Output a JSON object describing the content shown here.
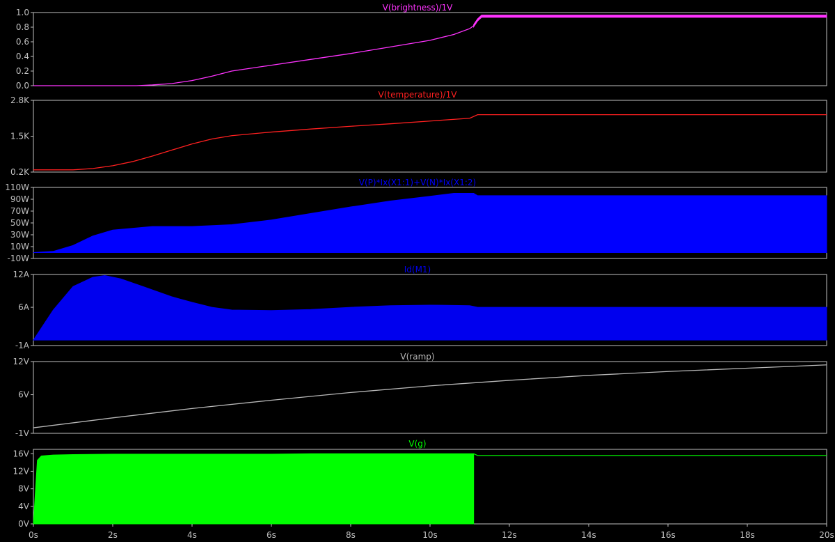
{
  "x_axis": {
    "ticks": [
      "0s",
      "2s",
      "4s",
      "6s",
      "8s",
      "10s",
      "12s",
      "14s",
      "16s",
      "18s",
      "20s"
    ],
    "range": [
      0,
      20
    ]
  },
  "chart_data": [
    {
      "type": "line",
      "title": "V(brightness)/1V",
      "color": "#ff33ff",
      "ylim": [
        0,
        1.0
      ],
      "yticks": [
        {
          "v": 1.0,
          "label": "1.0"
        },
        {
          "v": 0.8,
          "label": "0.8"
        },
        {
          "v": 0.6,
          "label": "0.6"
        },
        {
          "v": 0.4,
          "label": "0.4"
        },
        {
          "v": 0.2,
          "label": "0.2"
        },
        {
          "v": 0.0,
          "label": "0.0"
        }
      ],
      "band": 0.015,
      "band_start": 11.1,
      "x": [
        0,
        2.6,
        3.0,
        3.5,
        4.0,
        4.5,
        5.0,
        6.0,
        7.0,
        8.0,
        9.0,
        10.0,
        10.6,
        11.0,
        11.1,
        11.2,
        11.3,
        12,
        14,
        16,
        18,
        20
      ],
      "y": [
        0,
        0,
        0.01,
        0.03,
        0.07,
        0.13,
        0.2,
        0.28,
        0.36,
        0.44,
        0.53,
        0.62,
        0.7,
        0.78,
        0.82,
        0.9,
        0.95,
        0.95,
        0.95,
        0.95,
        0.95,
        0.95
      ]
    },
    {
      "type": "line",
      "title": "V(temperature)/1V",
      "color": "#ff2020",
      "ylim": [
        200,
        2800
      ],
      "yticks": [
        {
          "v": 2800,
          "label": "2.8K"
        },
        {
          "v": 1500,
          "label": "1.5K"
        },
        {
          "v": 200,
          "label": "0.2K"
        }
      ],
      "x": [
        0,
        1.0,
        1.5,
        2.0,
        2.5,
        3.0,
        3.5,
        4.0,
        4.5,
        5.0,
        6.0,
        7.0,
        8.0,
        9.0,
        10.0,
        11.0,
        11.2,
        12,
        14,
        16,
        18,
        20
      ],
      "y": [
        280,
        280,
        330,
        430,
        580,
        780,
        1000,
        1220,
        1400,
        1520,
        1650,
        1760,
        1860,
        1950,
        2050,
        2150,
        2280,
        2280,
        2280,
        2280,
        2280,
        2280
      ]
    },
    {
      "type": "area",
      "title": "V(P)*Ix(X1:1)+V(N)*Ix(X1:2)",
      "color": "#0000ff",
      "ylim": [
        -10,
        110
      ],
      "yticks": [
        {
          "v": 110,
          "label": "110W"
        },
        {
          "v": 90,
          "label": "90W"
        },
        {
          "v": 70,
          "label": "70W"
        },
        {
          "v": 50,
          "label": "50W"
        },
        {
          "v": 30,
          "label": "30W"
        },
        {
          "v": 10,
          "label": "10W"
        },
        {
          "v": -10,
          "label": "-10W"
        }
      ],
      "baseline": 0,
      "x": [
        0,
        0.5,
        1.0,
        1.5,
        2.0,
        3.0,
        4.0,
        5.0,
        6.0,
        7.0,
        8.0,
        9.0,
        10.0,
        10.6,
        11.1,
        11.2,
        12,
        14,
        16,
        18,
        20
      ],
      "y": [
        0,
        2,
        12,
        28,
        38,
        44,
        44,
        47,
        55,
        66,
        77,
        87,
        95,
        100,
        100,
        96,
        96,
        96,
        96,
        96,
        96
      ]
    },
    {
      "type": "area",
      "title": "Id(M1)",
      "color": "#0000ee",
      "ylim": [
        -1,
        12
      ],
      "yticks": [
        {
          "v": 12,
          "label": "12A"
        },
        {
          "v": 6,
          "label": "6A"
        },
        {
          "v": -1,
          "label": "-1A"
        }
      ],
      "baseline": 0,
      "x": [
        0,
        0.5,
        1.0,
        1.5,
        1.8,
        2.2,
        2.8,
        3.5,
        4.0,
        4.5,
        5.0,
        6.0,
        7.0,
        8.0,
        9.0,
        10.0,
        11.0,
        11.2,
        12,
        14,
        16,
        18,
        20
      ],
      "y": [
        0,
        5.5,
        9.8,
        11.5,
        11.8,
        11.2,
        9.7,
        7.9,
        6.9,
        6.0,
        5.5,
        5.4,
        5.6,
        6.0,
        6.3,
        6.4,
        6.3,
        6.0,
        6.0,
        6.0,
        6.0,
        6.0,
        6.0
      ]
    },
    {
      "type": "line",
      "title": "V(ramp)",
      "color": "#b8b8b8",
      "ylim": [
        -1,
        12
      ],
      "yticks": [
        {
          "v": 12,
          "label": "12V"
        },
        {
          "v": 6,
          "label": "6V"
        },
        {
          "v": -1,
          "label": "-1V"
        }
      ],
      "x": [
        0,
        2,
        4,
        6,
        8,
        10,
        12,
        14,
        16,
        18,
        20
      ],
      "y": [
        0.0,
        1.8,
        3.5,
        5.0,
        6.4,
        7.6,
        8.6,
        9.5,
        10.2,
        10.8,
        11.4
      ]
    },
    {
      "type": "area",
      "title": "V(g)",
      "color": "#00ff00",
      "ylim": [
        0,
        17
      ],
      "yticks": [
        {
          "v": 16,
          "label": "16V"
        },
        {
          "v": 12,
          "label": "12V"
        },
        {
          "v": 8,
          "label": "8V"
        },
        {
          "v": 4,
          "label": "4V"
        },
        {
          "v": 0,
          "label": "0V"
        }
      ],
      "baseline": 0,
      "area_end": 11.1,
      "x": [
        0,
        0.1,
        0.2,
        0.5,
        1.0,
        2.0,
        4.0,
        6.0,
        7.0,
        8.0,
        10.0,
        11.1
      ],
      "y": [
        0,
        14.5,
        15.5,
        15.7,
        15.8,
        15.9,
        15.9,
        15.9,
        16.0,
        16.0,
        16.0,
        16.0
      ],
      "line_x": [
        11.1,
        11.2,
        12,
        14,
        16,
        18,
        20
      ],
      "line_y": [
        16.0,
        15.6,
        15.6,
        15.6,
        15.6,
        15.6,
        15.6
      ]
    }
  ]
}
